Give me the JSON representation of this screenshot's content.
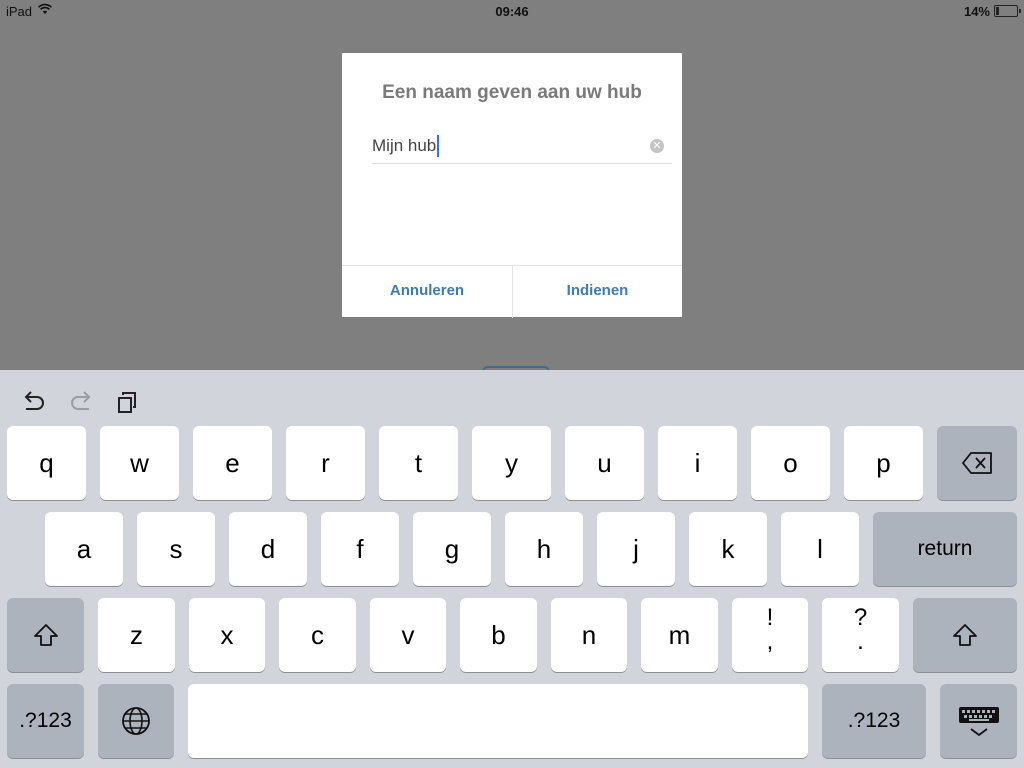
{
  "status_bar": {
    "device": "iPad",
    "time": "09:46",
    "battery": "14%"
  },
  "dialog": {
    "title": "Een naam geven aan uw hub",
    "input_value": "Mijn hub",
    "cancel_label": "Annuleren",
    "submit_label": "Indienen"
  },
  "keyboard": {
    "row1": [
      "q",
      "w",
      "e",
      "r",
      "t",
      "y",
      "u",
      "i",
      "o",
      "p"
    ],
    "row2": [
      "a",
      "s",
      "d",
      "f",
      "g",
      "h",
      "j",
      "k",
      "l"
    ],
    "row3": [
      "z",
      "x",
      "c",
      "v",
      "b",
      "n",
      "m"
    ],
    "punct1": {
      "top": "!",
      "bottom": ","
    },
    "punct2": {
      "top": "?",
      "bottom": "."
    },
    "return_label": "return",
    "numbers_label": ".?123",
    "icons": [
      "undo-icon",
      "redo-icon",
      "paste-icon",
      "backspace-icon",
      "shift-icon",
      "globe-icon",
      "keyboard-dismiss-icon"
    ]
  }
}
